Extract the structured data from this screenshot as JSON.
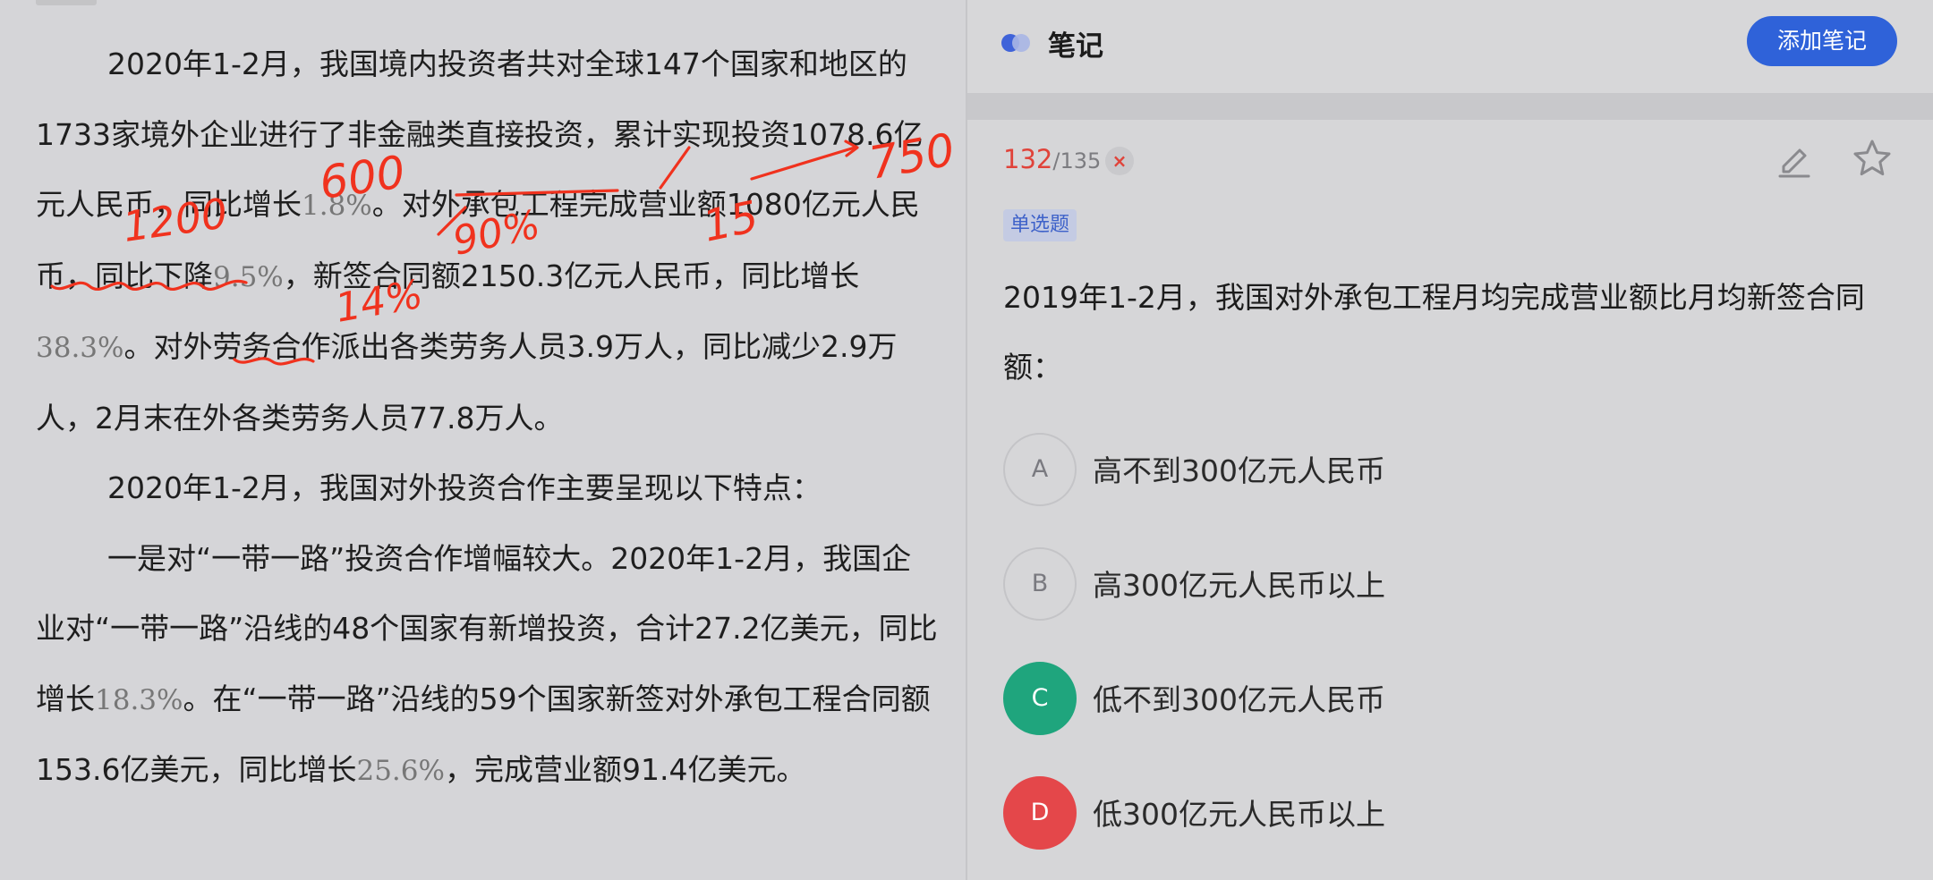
{
  "passage": {
    "paragraphs": [
      {
        "runs": [
          {
            "t": "2020年1-2月，我国境内投资者共对全球147个国家和地区的1733家境外企业进行了非金融类直接投资，累计实现投资1078.6亿元人民币，同比增长"
          },
          {
            "t": "1.8%",
            "pct": true
          },
          {
            "t": "。对外承包工程完成营业额1080亿元人民币，同比下降"
          },
          {
            "t": "9.5%",
            "pct": true
          },
          {
            "t": "，新签合同额2150.3亿元人民币，同比增长"
          },
          {
            "t": "38.3%",
            "pct": true
          },
          {
            "t": "。对外劳务合作派出各类劳务人员3.9万人，同比减少2.9万人，2月末在外各类劳务人员77.8万人。"
          }
        ]
      },
      {
        "runs": [
          {
            "t": "2020年1-2月，我国对外投资合作主要呈现以下特点："
          }
        ]
      },
      {
        "runs": [
          {
            "t": "一是对“一带一路”投资合作增幅较大。2020年1-2月，我国企业对“一带一路”沿线的48个国家有新增投资，合计27.2亿美元，同比增长"
          },
          {
            "t": "18.3%",
            "pct": true
          },
          {
            "t": "。在“一带一路”沿线的59个国家新签对外承包工程合同额153.6亿美元，同比增长"
          },
          {
            "t": "25.6%",
            "pct": true
          },
          {
            "t": "，完成营业额91.4亿美元。"
          }
        ]
      }
    ],
    "handwriting": [
      "1200",
      "600",
      "90%",
      "14%",
      "15",
      "750"
    ]
  },
  "header": {
    "title": "笔记",
    "add_note_label": "添加笔记"
  },
  "question": {
    "current": "132",
    "total": "/135",
    "wrong_mark": "×",
    "type": "单选题",
    "stem": "2019年1-2月，我国对外承包工程月均完成营业额比月均新签合同额：",
    "options": [
      {
        "letter": "A",
        "text": "高不到300亿元人民币",
        "state": "normal"
      },
      {
        "letter": "B",
        "text": "高300亿元人民币以上",
        "state": "normal"
      },
      {
        "letter": "C",
        "text": "低不到300亿元人民币",
        "state": "correct"
      },
      {
        "letter": "D",
        "text": "低300亿元人民币以上",
        "state": "wrong"
      }
    ]
  },
  "colors": {
    "accent": "#2f62d9",
    "correct": "#1fa57d",
    "wrong": "#e4474a",
    "ink": "#f0321e"
  },
  "icons": [
    "notes-icon",
    "edit-icon",
    "star-icon",
    "close-icon"
  ]
}
